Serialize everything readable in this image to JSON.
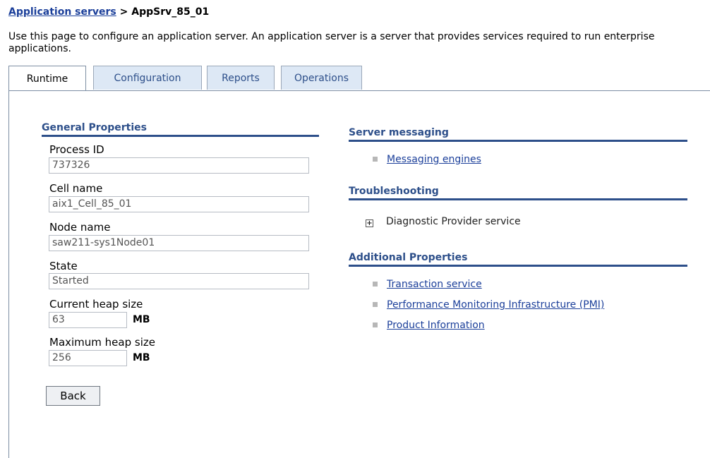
{
  "breadcrumb": {
    "parent_label": "Application servers",
    "separator": ">",
    "current": "AppSrv_85_01"
  },
  "intro": "Use this page to configure an application server. An application server is a server that provides services required to run enterprise applications.",
  "tabs": [
    {
      "label": "Runtime",
      "active": true
    },
    {
      "label": "Configuration",
      "active": false
    },
    {
      "label": "Reports",
      "active": false
    },
    {
      "label": "Operations",
      "active": false
    }
  ],
  "general_properties": {
    "title": "General Properties",
    "process_id": {
      "label": "Process ID",
      "value": "737326"
    },
    "cell_name": {
      "label": "Cell name",
      "value": "aix1_Cell_85_01"
    },
    "node_name": {
      "label": "Node name",
      "value": "saw211-sys1Node01"
    },
    "state": {
      "label": "State",
      "value": "Started"
    },
    "current_heap": {
      "label": "Current heap size",
      "value": "63",
      "unit": "MB"
    },
    "max_heap": {
      "label": "Maximum heap size",
      "value": "256",
      "unit": "MB"
    }
  },
  "back_label": "Back",
  "server_messaging": {
    "title": "Server messaging",
    "items": [
      "Messaging engines"
    ]
  },
  "troubleshooting": {
    "title": "Troubleshooting",
    "items": [
      "Diagnostic Provider service"
    ],
    "expand_symbol": "+"
  },
  "additional_properties": {
    "title": "Additional Properties",
    "items": [
      "Transaction service",
      "Performance Monitoring Infrastructure (PMI)",
      "Product Information"
    ]
  },
  "colors": {
    "link": "#1b3f9a",
    "heading": "#2d4f8a",
    "tab_inactive_bg": "#dde8f5"
  },
  "icons": {
    "bullet": "square-bullet-icon",
    "expand": "plus-expand-icon"
  }
}
